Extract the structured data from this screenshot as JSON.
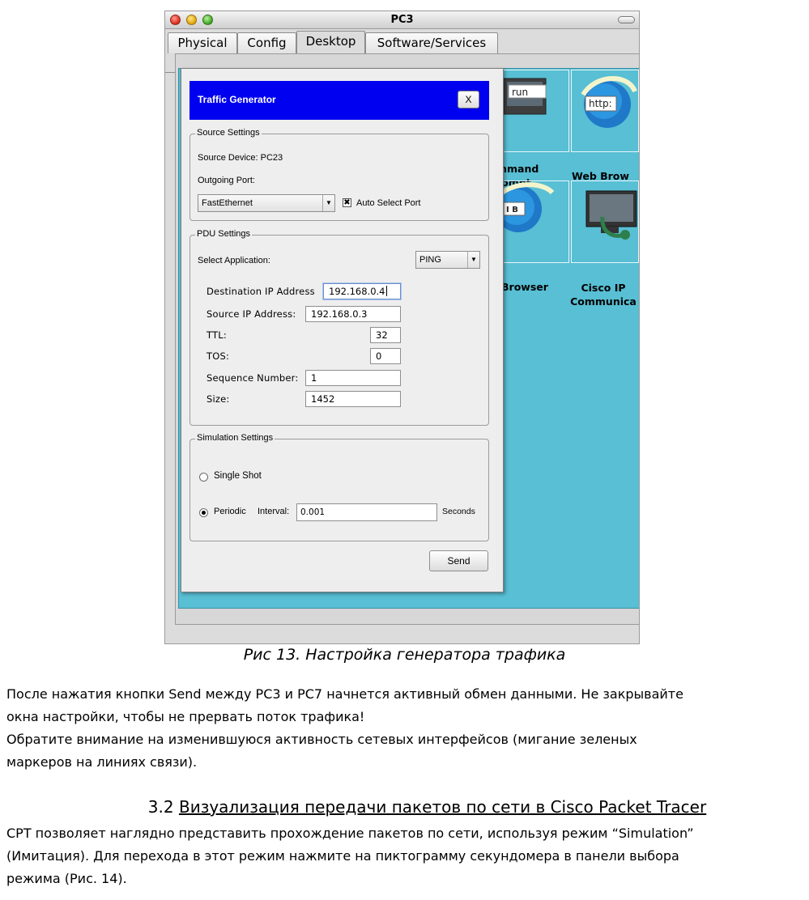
{
  "window": {
    "title": "PC3",
    "tabs": [
      "Physical",
      "Config",
      "Desktop",
      "Software/Services"
    ],
    "active_tab": "Desktop"
  },
  "desktop_icons": {
    "cmd": {
      "thumb": "run",
      "label_line1": "mmand",
      "label_line2": "rompt"
    },
    "web": {
      "thumb": "http:",
      "label": "Web Brow"
    },
    "mib": {
      "thumb": "I B",
      "label": "Browser"
    },
    "ipc": {
      "label_line1": "Cisco IP",
      "label_line2": "Communica"
    }
  },
  "dialog": {
    "title": "Traffic Generator",
    "close_label": "X",
    "source_settings": {
      "legend": "Source Settings",
      "source_device": "Source Device: PC23",
      "outgoing_port_label": "Outgoing Port:",
      "outgoing_port_value": "FastEthernet",
      "auto_select_label": "Auto Select Port",
      "auto_select_checked": true
    },
    "pdu_settings": {
      "legend": "PDU Settings",
      "select_app_label": "Select Application:",
      "select_app_value": "PING",
      "dest_ip_label": "Destination IP Address",
      "dest_ip_value": "192.168.0.4",
      "src_ip_label": "Source IP Address:",
      "src_ip_value": "192.168.0.3",
      "ttl_label": "TTL:",
      "ttl_value": "32",
      "tos_label": "TOS:",
      "tos_value": "0",
      "seq_label": "Sequence Number:",
      "seq_value": "1",
      "size_label": "Size:",
      "size_value": "1452"
    },
    "simulation_settings": {
      "legend": "Simulation Settings",
      "single_shot_label": "Single Shot",
      "periodic_label": "Periodic",
      "interval_label": "Interval:",
      "interval_value": "0.001",
      "seconds_label": "Seconds",
      "selected": "Periodic"
    },
    "send_label": "Send"
  },
  "doc": {
    "caption": "Рис 13. Настройка генератора трафика",
    "para1_line1": "После нажатия кнопки Send между PC3 и PC7 начнется активный обмен данными. Не закрывайте",
    "para1_line2": "окна настройки, чтобы не прервать поток трафика!",
    "para2_line1": "Обратите внимание на изменившуюся активность сетевых интерфейсов (мигание зеленых",
    "para2_line2": "маркеров на линиях связи).",
    "section_number": "3.2",
    "section_title": "Визуализация передачи пакетов по сети в Cisco Packet Tracer",
    "para3_line1": "CPT позволяет наглядно представить прохождение пакетов по сети, используя режим “Simulation”",
    "para3_line2": "(Имитация). Для перехода в этот режим нажмите на пиктограмму секундомера в панели выбора",
    "para3_line3": "режима (Рис. 14)."
  }
}
